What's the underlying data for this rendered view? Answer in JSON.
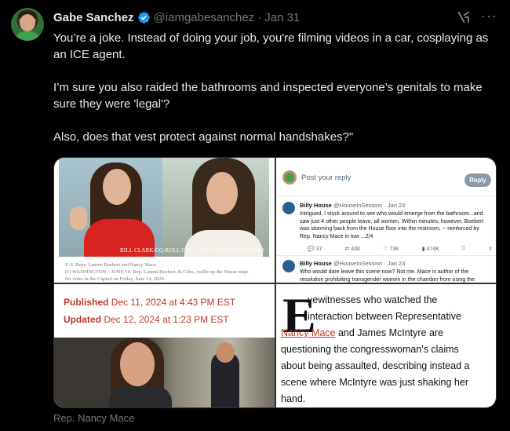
{
  "author": {
    "name": "Gabe Sanchez",
    "handle": "@iamgabesanchez",
    "separator": "·",
    "date": "Jan 31",
    "verified": true
  },
  "icons": {
    "verified": "verified-badge-icon",
    "grok": "grok-icon",
    "more": "more-icon"
  },
  "more_label": "···",
  "tweet": {
    "paragraphs": [
      "You’re a joke. Instead of doing your job, you're filming videos in a car, cosplaying as an ICE agent.",
      "I’m sure you also raided the bathrooms and inspected everyone’s genitals to make sure they were 'legal'?",
      "Also, does that vest protect against normal handshakes?\""
    ]
  },
  "media": {
    "image1": {
      "credit": "BILL CLARK/CQ-ROLL CALL, INC VIA GETTY IMAGES",
      "caption_line1": "U.S. Reps. Lauren Boebert and Nancy Mace.",
      "caption_line2": "(1) WASHINGTON – JUNE 14: Rep. Lauren Boebert, R-Colo., walks up the House steps",
      "caption_line3": "for votes in the Capitol on Friday, June 14, 2024."
    },
    "image2": {
      "reply_placeholder": "Post your reply",
      "reply_button": "Reply",
      "reply1": {
        "name": "Billy House",
        "handle_date": "@HouseInSession · Jan 23",
        "text": "Intrigued, I stuck around to see who would emerge from the bathroom...and saw just 4 other people leave, all women. Within minutes, however, Boebert was storming back from the House floor into the restroom, -- reinforced by Rep. Nancy Mace in tow ...2/4"
      },
      "actions": [
        "37",
        "400",
        "73K",
        "474K"
      ],
      "reply2": {
        "name": "Billy House",
        "handle_date": "@HouseInSession · Jan 23",
        "text": "Who would dare leave this scene now? Not me. Mace is author of the resolution prohibiting transgender women in the chamber from using the"
      }
    },
    "image3": {
      "published_label": "Published",
      "published_value": "Dec 11, 2024 at 4:43 PM EST",
      "updated_label": "Updated",
      "updated_value": "Dec 12, 2024 at 1:23 PM EST"
    },
    "image4": {
      "dropcap": "E",
      "line1": "yewitnesses who watched the",
      "line2": "interaction between Representative",
      "link": "Nancy Mace",
      "line3_rest": " and James McIntyre are",
      "line4": "questioning the congresswoman's claims",
      "line5": "about being assaulted, describing instead a",
      "line6": "scene where McIntyre was just shaking her",
      "line7": "hand."
    }
  },
  "alt_caption": "Rep. Nancy Mace",
  "colors": {
    "background": "#000000",
    "text": "#e7e9ea",
    "muted": "#71767b",
    "verified": "#1d9bf0",
    "accent_red": "#c0392b"
  }
}
